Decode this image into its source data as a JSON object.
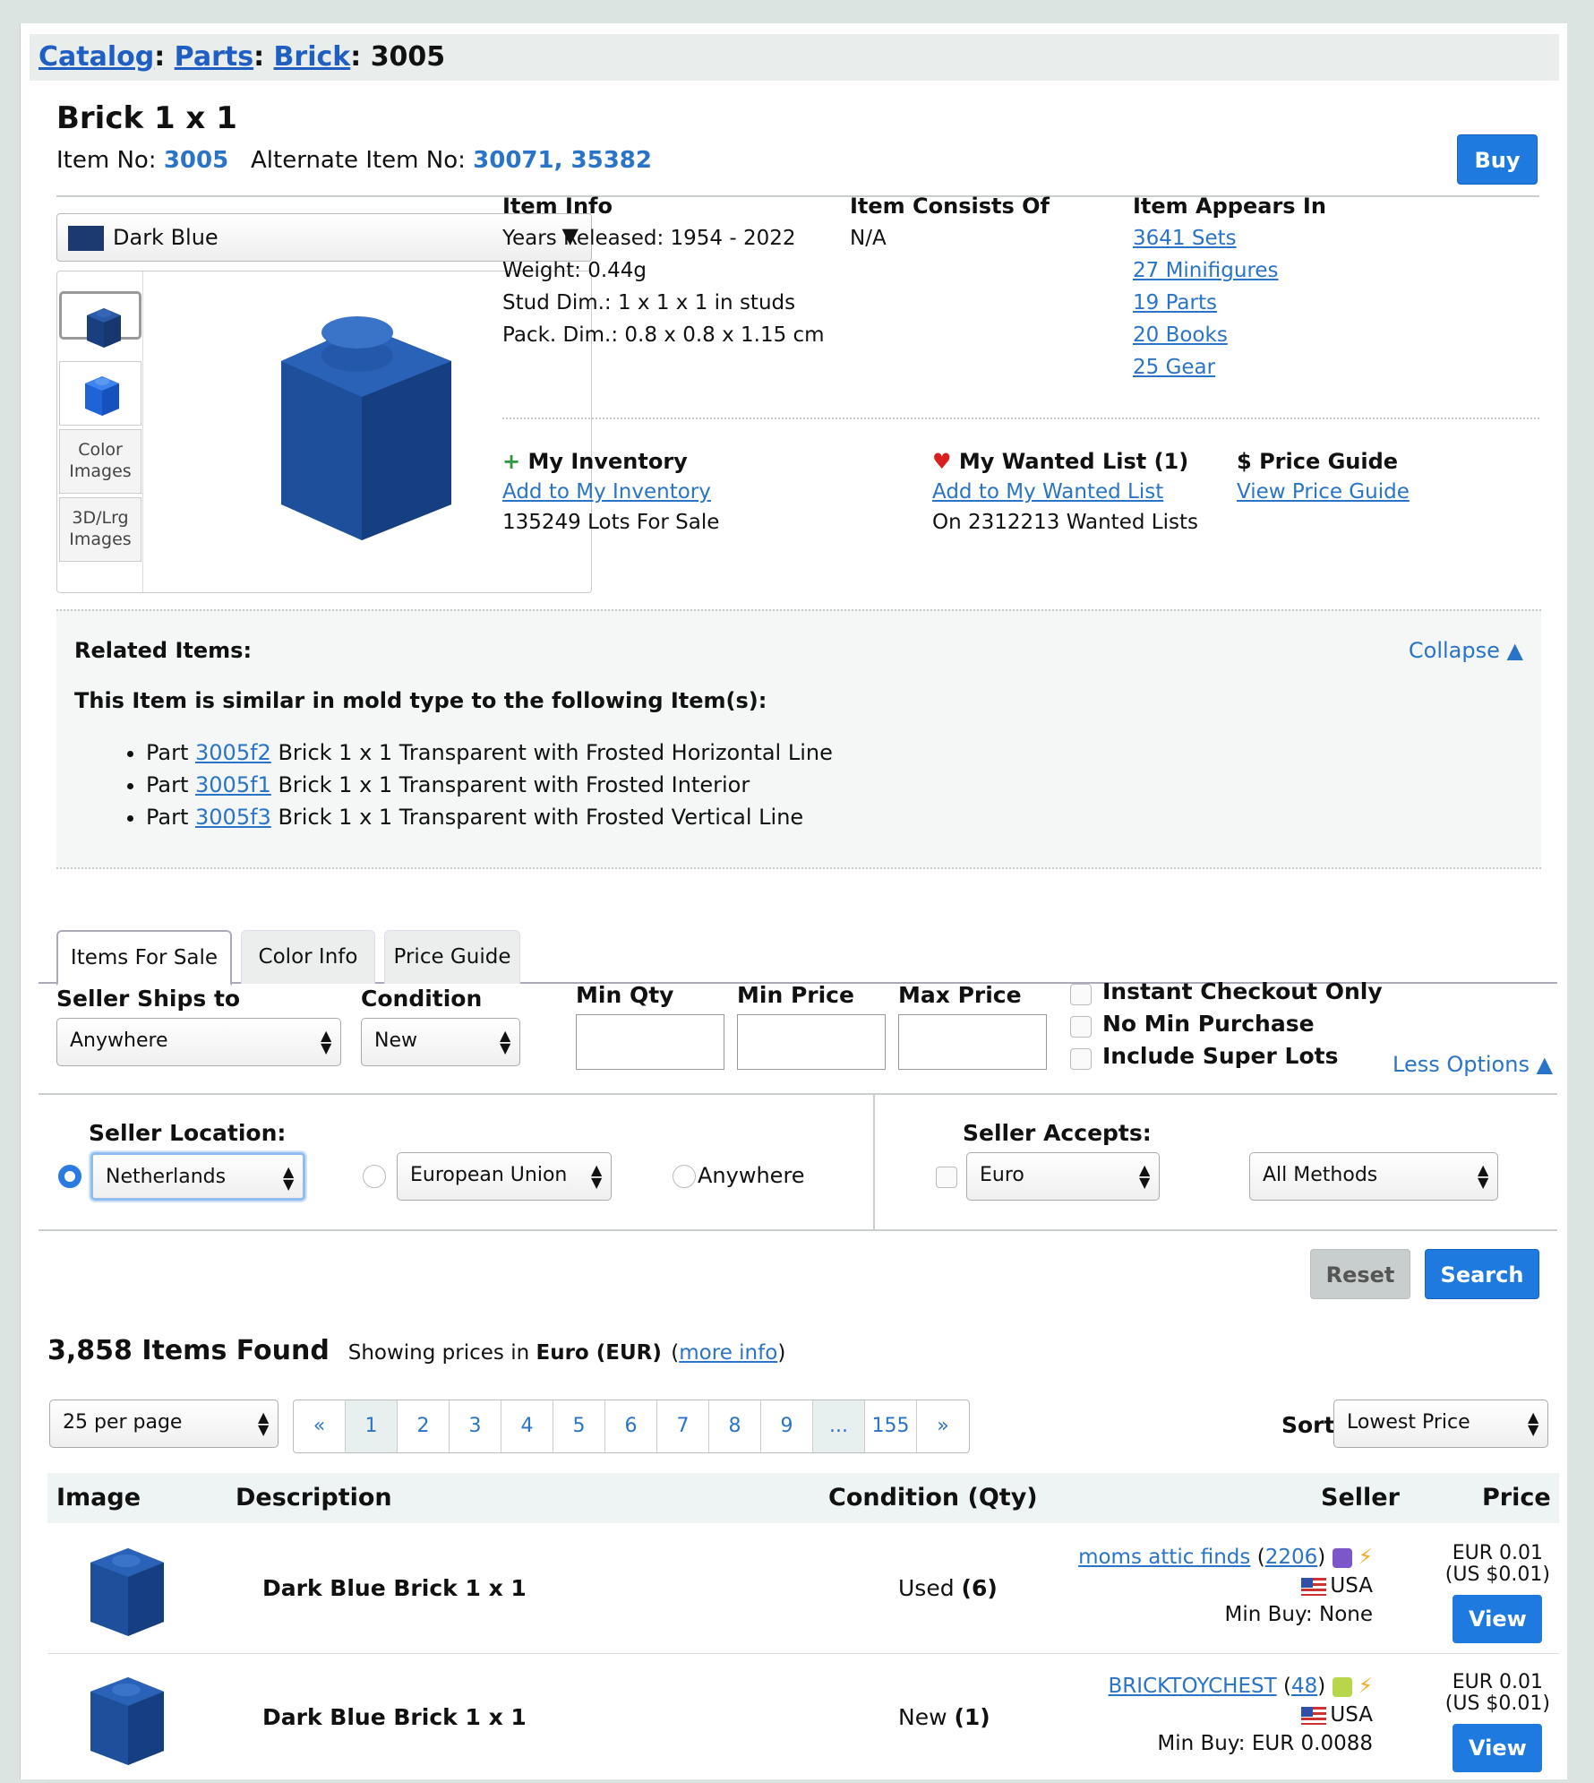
{
  "breadcrumb": {
    "catalog": "Catalog",
    "parts": "Parts",
    "brick": "Brick",
    "sep": ": ",
    "item": "3005"
  },
  "title": "Brick 1 x 1",
  "item_no_label": "Item No:",
  "item_no": "3005",
  "alt_no_label": "Alternate Item No:",
  "alt_no": "30071, 35382",
  "buy": "Buy",
  "color_select": "Dark Blue",
  "thumbs": {
    "color_images": "Color Images",
    "lrg_images": "3D/Lrg Images"
  },
  "item_info": {
    "title": "Item Info",
    "years": "Years Released: 1954 - 2022",
    "weight": "Weight: 0.44g",
    "stud": "Stud Dim.: 1 x 1 x 1 in studs",
    "pack": "Pack. Dim.: 0.8 x 0.8 x 1.15 cm"
  },
  "consists": {
    "title": "Item Consists Of",
    "value": "N/A"
  },
  "appears": {
    "title": "Item Appears In",
    "sets": "3641 Sets",
    "minifigs": "27 Minifigures",
    "parts": "19 Parts",
    "books": "20 Books",
    "gear": "25 Gear"
  },
  "inventory": {
    "title": "My Inventory",
    "link": "Add to My Inventory",
    "lots": "135249 Lots For Sale"
  },
  "wanted": {
    "title": "My Wanted List (1)",
    "link": "Add to My Wanted List",
    "count": "On 2312213 Wanted Lists"
  },
  "priceguide": {
    "title": "Price Guide",
    "link": "View Price Guide"
  },
  "related": {
    "heading": "Related Items:",
    "collapse": "Collapse",
    "subheading": "This Item is similar in mold type to the following Item(s):",
    "items": [
      {
        "prefix": "Part ",
        "id": "3005f2",
        "text": " Brick 1 x 1 Transparent with Frosted Horizontal Line"
      },
      {
        "prefix": "Part ",
        "id": "3005f1",
        "text": " Brick 1 x 1 Transparent with Frosted Interior"
      },
      {
        "prefix": "Part ",
        "id": "3005f3",
        "text": " Brick 1 x 1 Transparent with Frosted Vertical Line"
      }
    ]
  },
  "tabs": [
    "Items For Sale",
    "Color Info",
    "Price Guide"
  ],
  "filters": {
    "ships_label": "Seller Ships to",
    "ships_value": "Anywhere",
    "cond_label": "Condition",
    "cond_value": "New",
    "minqty": "Min Qty",
    "minprice": "Min Price",
    "maxprice": "Max Price",
    "instant": "Instant Checkout Only",
    "nomin": "No Min Purchase",
    "superlots": "Include Super Lots",
    "less": "Less Options",
    "loc_label": "Seller Location:",
    "loc_country": "Netherlands",
    "loc_region": "European Union",
    "loc_any": "Anywhere",
    "accepts_label": "Seller Accepts:",
    "currency": "Euro",
    "methods": "All Methods",
    "reset": "Reset",
    "search": "Search"
  },
  "results": {
    "count": "3,858 Items Found",
    "note_pre": "Showing prices in ",
    "currency": "Euro (EUR)",
    "more": "more info"
  },
  "perpage": "25 per page",
  "pages": [
    "«",
    "1",
    "2",
    "3",
    "4",
    "5",
    "6",
    "7",
    "8",
    "9",
    "...",
    "155",
    "»"
  ],
  "sort_label": "Sort",
  "sort_value": "Lowest Price",
  "table": {
    "image": "Image",
    "desc": "Description",
    "cond": "Condition (Qty)",
    "seller": "Seller",
    "price": "Price"
  },
  "rows": [
    {
      "desc": "Dark Blue Brick 1 x 1",
      "cond": "Used",
      "qty": "(6)",
      "seller": "moms attic finds",
      "fb": "2206",
      "country": "USA",
      "minbuy": "Min Buy: None",
      "price": "EUR 0.01",
      "usd": "(US $0.01)",
      "view": "View",
      "box": "#7c57c9"
    },
    {
      "desc": "Dark Blue Brick 1 x 1",
      "cond": "New",
      "qty": "(1)",
      "seller": "BRICKTOYCHEST",
      "fb": "48",
      "country": "USA",
      "minbuy": "Min Buy: EUR 0.0088",
      "price": "EUR 0.01",
      "usd": "(US $0.01)",
      "view": "View",
      "box": "#b7d64a"
    }
  ],
  "colors": {
    "accent": "#1f7ae0",
    "link": "#2a74c8",
    "swatch": "#1d3a6e",
    "brick": "#1d4f9a"
  }
}
